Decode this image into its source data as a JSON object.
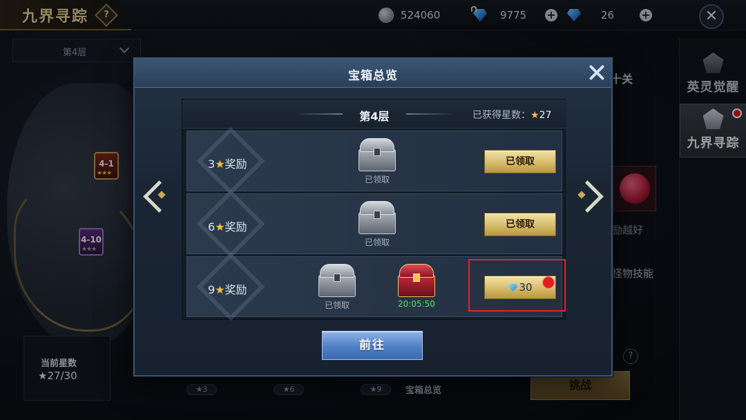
{
  "topbar": {
    "title": "九界寻踪",
    "help": "?",
    "silver": "524060",
    "bound_diamond": "9775",
    "diamond": "26",
    "plus": "+",
    "close": "✕"
  },
  "background": {
    "floor_dropdown": "第4层",
    "map_nodes": [
      {
        "label": "4-1",
        "stars": "★★★"
      },
      {
        "label": "4-10",
        "stars": "★★★"
      }
    ],
    "current_stars_label": "当前星数",
    "current_stars_value": "★27/30",
    "progress_ticks": [
      "★3",
      "★6",
      "★9"
    ],
    "overview_label": "宝箱总览",
    "challenge_label": "挑战",
    "help": "?",
    "right_title": "十关",
    "right_text_1": "励越好",
    "right_text_2": "怪物技能",
    "side_items": [
      {
        "label": "英灵觉醒"
      },
      {
        "label": "九界寻踪"
      }
    ]
  },
  "modal": {
    "title": "宝箱总览",
    "floor_name": "第4层",
    "earned_label": "已获得星数：",
    "earned_star": "★",
    "earned_value": "27",
    "rows": [
      {
        "count": "3",
        "star": "★",
        "label": "奖励",
        "chests": [
          {
            "caption": "已领取",
            "style": "silver"
          }
        ],
        "button": "已领取"
      },
      {
        "count": "6",
        "star": "★",
        "label": "奖励",
        "chests": [
          {
            "caption": "已领取",
            "style": "silver"
          }
        ],
        "button": "已领取"
      },
      {
        "count": "9",
        "star": "★",
        "label": "奖励",
        "chests": [
          {
            "caption": "已领取",
            "style": "silver"
          },
          {
            "caption": "20:05:50",
            "style": "red"
          }
        ],
        "button_price": "30"
      }
    ],
    "goto_label": "前往"
  },
  "colors": {
    "gold": "#d9bf72",
    "star": "#f4c430",
    "timer": "#5de35d",
    "highlight": "#e0262b",
    "blue_button": "#4f7fc6"
  }
}
